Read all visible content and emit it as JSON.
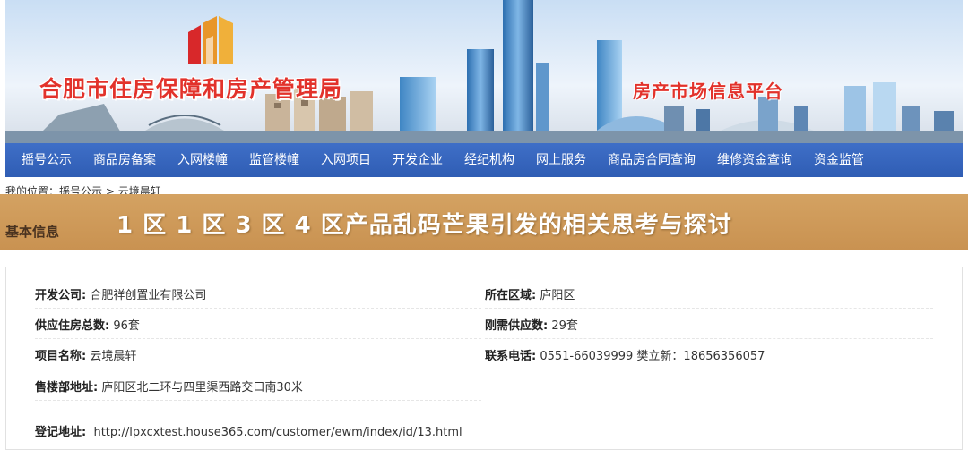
{
  "header": {
    "org_title": "合肥市住房保障和房产管理局",
    "platform_title": "房产市场信息平台",
    "logo_icon": "building-logo-icon",
    "colors": {
      "title_red": "#e2322b",
      "nav_blue": "#3a68c2",
      "section_tan": "#cf9a59"
    }
  },
  "nav": {
    "items": [
      {
        "label": "摇号公示"
      },
      {
        "label": "商品房备案"
      },
      {
        "label": "入网楼幢"
      },
      {
        "label": "监管楼幢"
      },
      {
        "label": "入网项目"
      },
      {
        "label": "开发企业"
      },
      {
        "label": "经纪机构"
      },
      {
        "label": "网上服务"
      },
      {
        "label": "商品房合同查询"
      },
      {
        "label": "维修资金查询"
      },
      {
        "label": "资金监管"
      }
    ]
  },
  "breadcrumb": {
    "prefix": "我的位置：",
    "link": "摇号公示",
    "separator": " > ",
    "current": "云境晨轩"
  },
  "section": {
    "label": "基本信息",
    "overlay_title": "1 区 1 区 3 区 4 区产品乱码芒果引发的相关思考与探讨"
  },
  "info": {
    "developer": {
      "label": "开发公司:",
      "value": "合肥祥创置业有限公司"
    },
    "district": {
      "label": "所在区域:",
      "value": "庐阳区"
    },
    "supply_total": {
      "label": "供应住房总数:",
      "value": "96套"
    },
    "rigid_supply": {
      "label": "刚需供应数:",
      "value": "29套"
    },
    "project_name": {
      "label": "项目名称:",
      "value": "云境晨轩"
    },
    "phone": {
      "label": "联系电话:",
      "value": "0551-66039999 樊立新：18656356057"
    },
    "sales_address": {
      "label": "售楼部地址:",
      "value": "庐阳区北二环与四里渠西路交口南30米"
    },
    "register_address": {
      "label": "登记地址:",
      "value": "http://lpxcxtest.house365.com/customer/ewm/index/id/13.html"
    }
  }
}
